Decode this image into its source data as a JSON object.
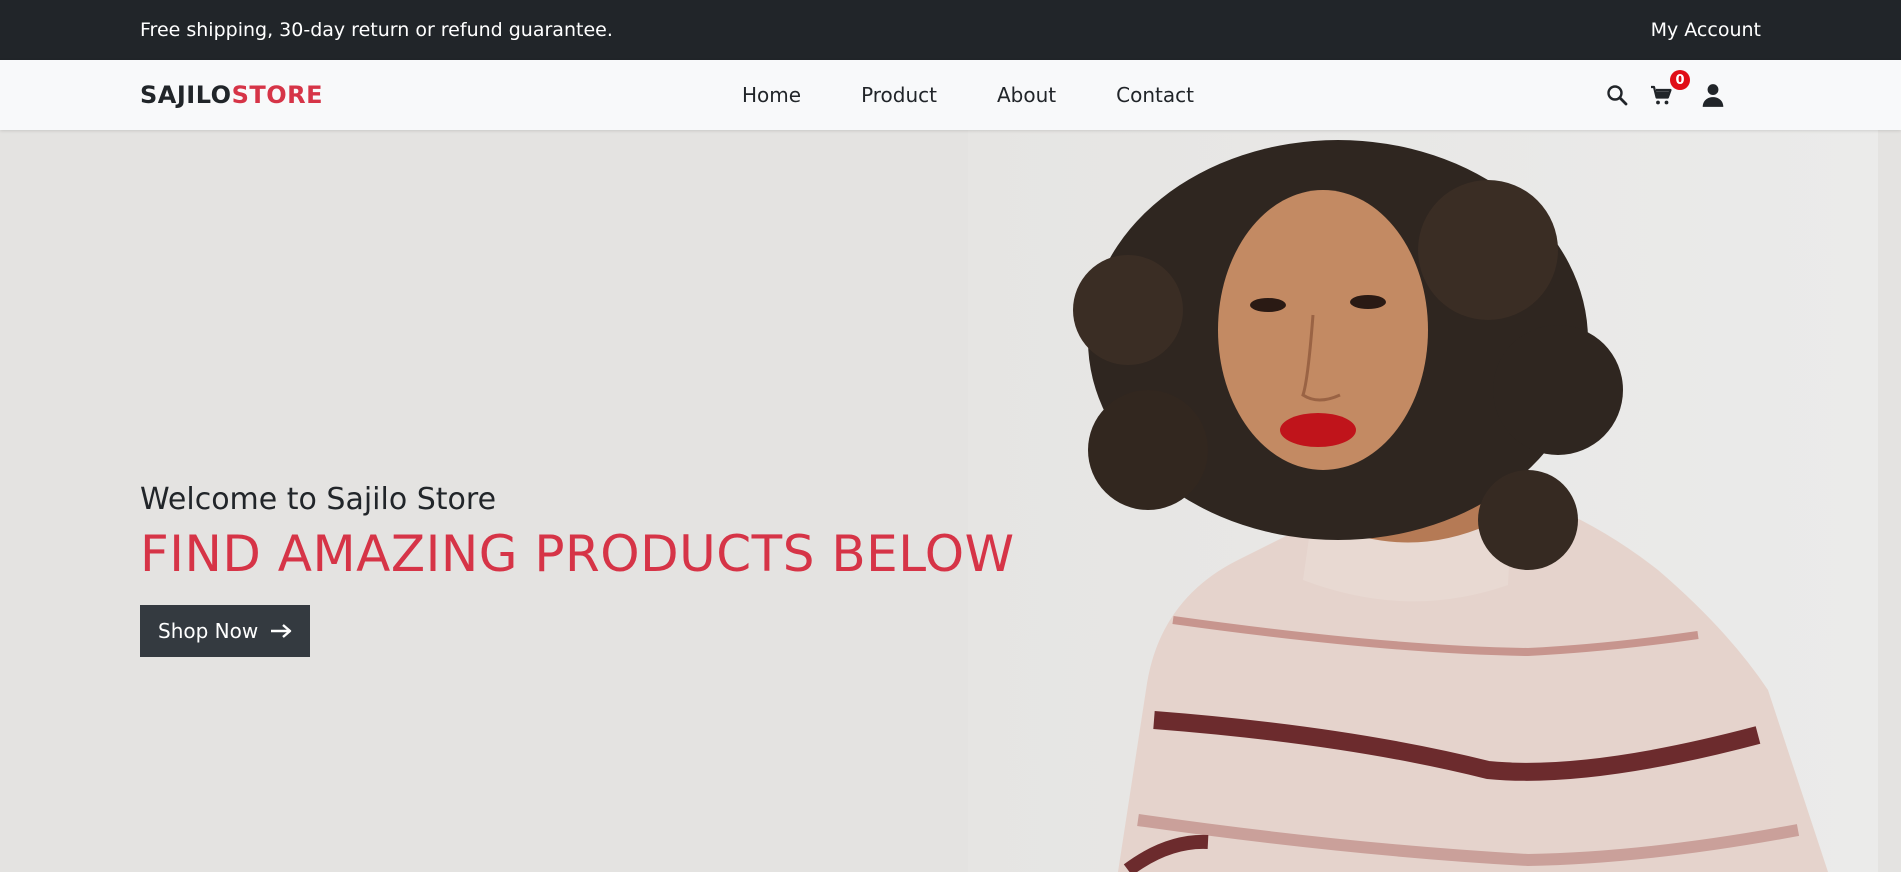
{
  "topbar": {
    "announcement": "Free shipping, 30-day return or refund guarantee.",
    "account_link": "My Account"
  },
  "navbar": {
    "logo_part1": "SAJILO",
    "logo_part2": "STORE",
    "links": [
      {
        "label": "Home"
      },
      {
        "label": "Product"
      },
      {
        "label": "About"
      },
      {
        "label": "Contact"
      }
    ],
    "cart_count": "0",
    "icons": [
      "search-icon",
      "cart-icon",
      "user-icon"
    ]
  },
  "hero": {
    "welcome": "Welcome to Sajilo Store",
    "headline": "FIND AMAZING PRODUCTS BELOW",
    "button_label": "Shop Now",
    "image_alt": "Model with curly hair wearing a striped sweater"
  },
  "colors": {
    "dark": "#212529",
    "accent": "#d63447",
    "badge": "#e00d16",
    "button": "#343a40"
  }
}
